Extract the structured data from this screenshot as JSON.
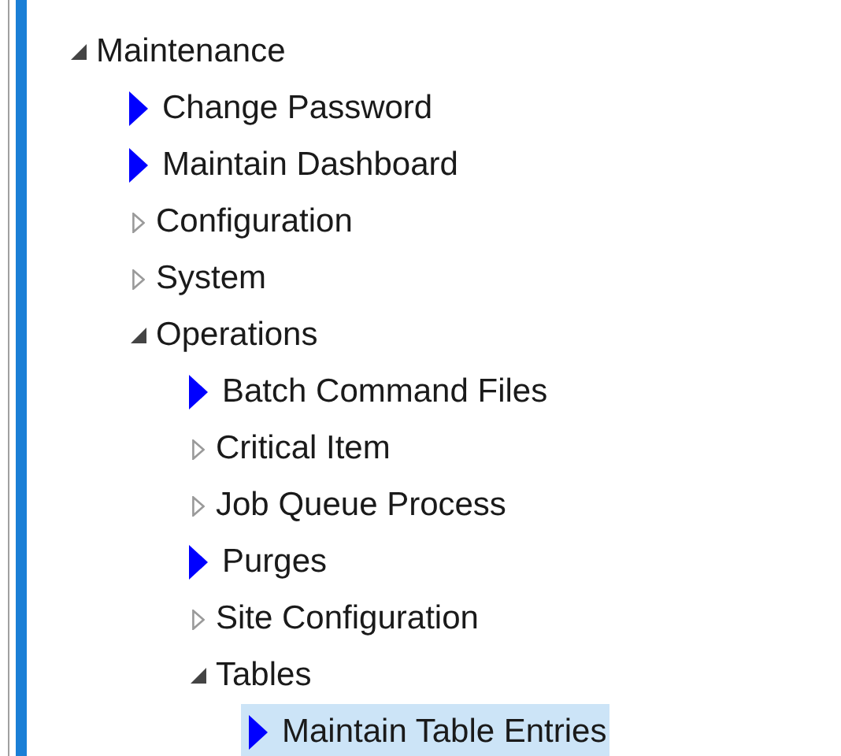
{
  "tree": [
    {
      "label": "Maintenance",
      "kind": "folder",
      "expanded": true,
      "children": [
        {
          "label": "Change Password",
          "kind": "leaf",
          "selected": false
        },
        {
          "label": "Maintain Dashboard",
          "kind": "leaf",
          "selected": false
        },
        {
          "label": "Configuration",
          "kind": "folder",
          "expanded": false
        },
        {
          "label": "System",
          "kind": "folder",
          "expanded": false
        },
        {
          "label": "Operations",
          "kind": "folder",
          "expanded": true,
          "children": [
            {
              "label": "Batch Command Files",
              "kind": "leaf",
              "selected": false
            },
            {
              "label": "Critical Item",
              "kind": "folder",
              "expanded": false
            },
            {
              "label": "Job Queue Process",
              "kind": "folder",
              "expanded": false
            },
            {
              "label": "Purges",
              "kind": "leaf",
              "selected": false
            },
            {
              "label": "Site Configuration",
              "kind": "folder",
              "expanded": false
            },
            {
              "label": "Tables",
              "kind": "folder",
              "expanded": true,
              "children": [
                {
                  "label": "Maintain Table Entries",
                  "kind": "leaf",
                  "selected": true
                }
              ]
            }
          ]
        }
      ]
    }
  ]
}
